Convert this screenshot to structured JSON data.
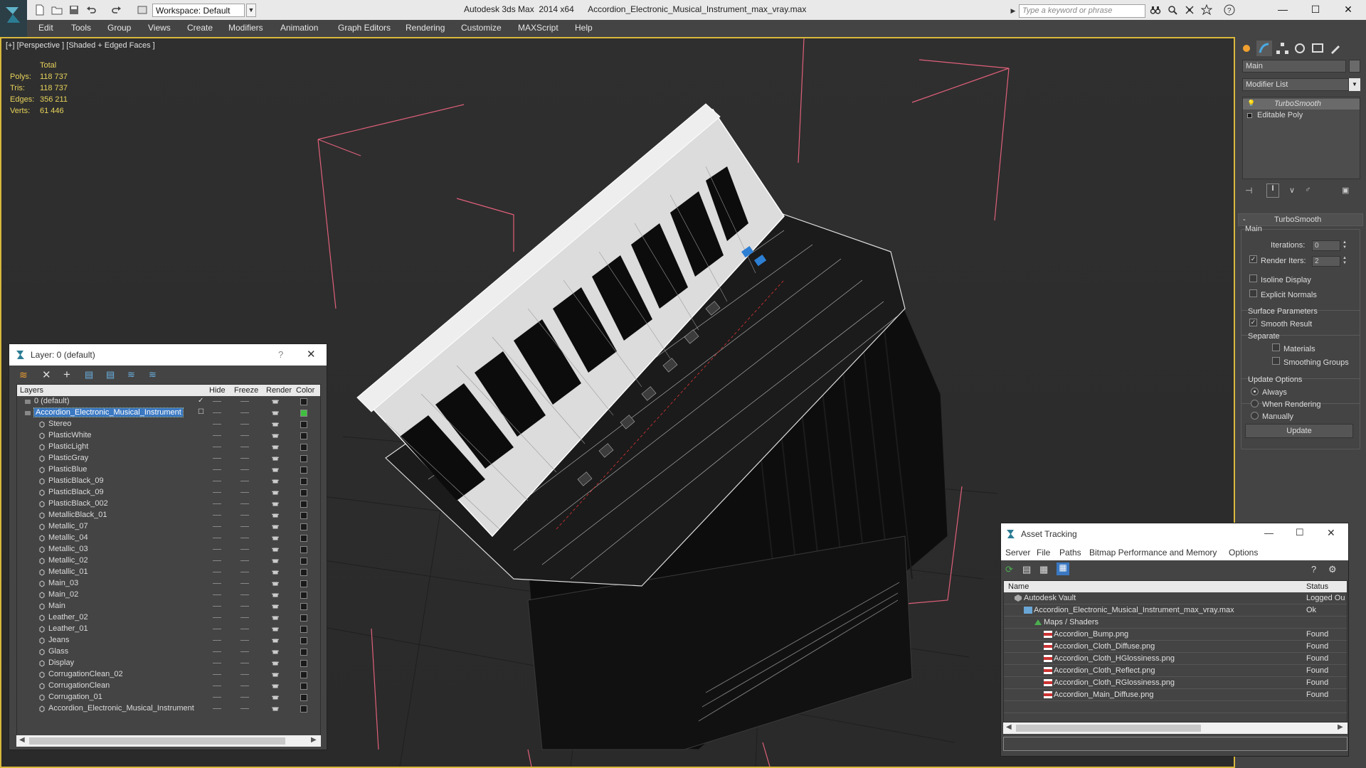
{
  "titlebar": {
    "workspace_label": "Workspace: Default",
    "title": "Autodesk 3ds Max  2014 x64      Accordion_Electronic_Musical_Instrument_max_vray.max",
    "search_placeholder": "Type a keyword or phrase"
  },
  "menu": [
    "Edit",
    "Tools",
    "Group",
    "Views",
    "Create",
    "Modifiers",
    "Animation",
    "Graph Editors",
    "Rendering",
    "Customize",
    "MAXScript",
    "Help"
  ],
  "viewport": {
    "label": "[+] [Perspective ] [Shaded + Edged Faces ]",
    "stats": {
      "header": "Total",
      "rows": [
        {
          "k": "Polys:",
          "v": "118 737"
        },
        {
          "k": "Tris:",
          "v": "118 737"
        },
        {
          "k": "Edges:",
          "v": "356 211"
        },
        {
          "k": "Verts:",
          "v": "61 446"
        }
      ]
    }
  },
  "command_panel": {
    "object_name": "Main",
    "modifier_list": "Modifier List",
    "stack": [
      "TurboSmooth",
      "Editable Poly"
    ],
    "rollout_title": "TurboSmooth",
    "main_group": "Main",
    "iterations_label": "Iterations:",
    "iterations_value": "0",
    "render_iters_label": "Render Iters:",
    "render_iters_value": "2",
    "isoline_display": "Isoline Display",
    "explicit_normals": "Explicit Normals",
    "surface_parameters": "Surface Parameters",
    "smooth_result": "Smooth Result",
    "separate": "Separate",
    "materials": "Materials",
    "smoothing_groups": "Smoothing Groups",
    "update_options": "Update Options",
    "always": "Always",
    "when_rendering": "When Rendering",
    "manually": "Manually",
    "update_button": "Update"
  },
  "layer_dialog": {
    "title": "Layer: 0 (default)",
    "columns": [
      "Layers",
      "Hide",
      "Freeze",
      "Render",
      "Color"
    ],
    "rows": [
      {
        "name": "0 (default)",
        "level": 0,
        "checked": true,
        "color": "#1a1a1a"
      },
      {
        "name": "Accordion_Electronic_Musical_Instrument",
        "level": 0,
        "selected": true,
        "color": "#3fbf3f"
      },
      {
        "name": "Stereo",
        "level": 1
      },
      {
        "name": "PlasticWhite",
        "level": 1
      },
      {
        "name": "PlasticLight",
        "level": 1
      },
      {
        "name": "PlasticGray",
        "level": 1
      },
      {
        "name": "PlasticBlue",
        "level": 1
      },
      {
        "name": "PlasticBlack_09",
        "level": 1
      },
      {
        "name": "PlasticBlack_09",
        "level": 1
      },
      {
        "name": "PlasticBlack_002",
        "level": 1
      },
      {
        "name": "MetallicBlack_01",
        "level": 1
      },
      {
        "name": "Metallic_07",
        "level": 1
      },
      {
        "name": "Metallic_04",
        "level": 1
      },
      {
        "name": "Metallic_03",
        "level": 1
      },
      {
        "name": "Metallic_02",
        "level": 1
      },
      {
        "name": "Metallic_01",
        "level": 1
      },
      {
        "name": "Main_03",
        "level": 1
      },
      {
        "name": "Main_02",
        "level": 1
      },
      {
        "name": "Main",
        "level": 1
      },
      {
        "name": "Leather_02",
        "level": 1
      },
      {
        "name": "Leather_01",
        "level": 1
      },
      {
        "name": "Jeans",
        "level": 1
      },
      {
        "name": "Glass",
        "level": 1
      },
      {
        "name": "Display",
        "level": 1
      },
      {
        "name": "CorrugationClean_02",
        "level": 1
      },
      {
        "name": "CorrugationClean",
        "level": 1
      },
      {
        "name": "Corrugation_01",
        "level": 1
      },
      {
        "name": "Accordion_Electronic_Musical_Instrument",
        "level": 1
      }
    ]
  },
  "asset_dialog": {
    "title": "Asset Tracking",
    "menu": [
      "Server",
      "File",
      "Paths",
      "Bitmap Performance and Memory",
      "Options"
    ],
    "columns": [
      "Name",
      "Status"
    ],
    "rows": [
      {
        "name": "Autodesk Vault",
        "status": "Logged Ou",
        "level": 0,
        "icon": "vault"
      },
      {
        "name": "Accordion_Electronic_Musical_Instrument_max_vray.max",
        "status": "Ok",
        "level": 1,
        "icon": "max"
      },
      {
        "name": "Maps / Shaders",
        "status": "",
        "level": 2,
        "icon": "maps"
      },
      {
        "name": "Accordion_Bump.png",
        "status": "Found",
        "level": 3,
        "icon": "png"
      },
      {
        "name": "Accordion_Cloth_Diffuse.png",
        "status": "Found",
        "level": 3,
        "icon": "png"
      },
      {
        "name": "Accordion_Cloth_HGlossiness.png",
        "status": "Found",
        "level": 3,
        "icon": "png"
      },
      {
        "name": "Accordion_Cloth_Reflect.png",
        "status": "Found",
        "level": 3,
        "icon": "png"
      },
      {
        "name": "Accordion_Cloth_RGlossiness.png",
        "status": "Found",
        "level": 3,
        "icon": "png"
      },
      {
        "name": "Accordion_Main_Diffuse.png",
        "status": "Found",
        "level": 3,
        "icon": "png"
      }
    ]
  }
}
